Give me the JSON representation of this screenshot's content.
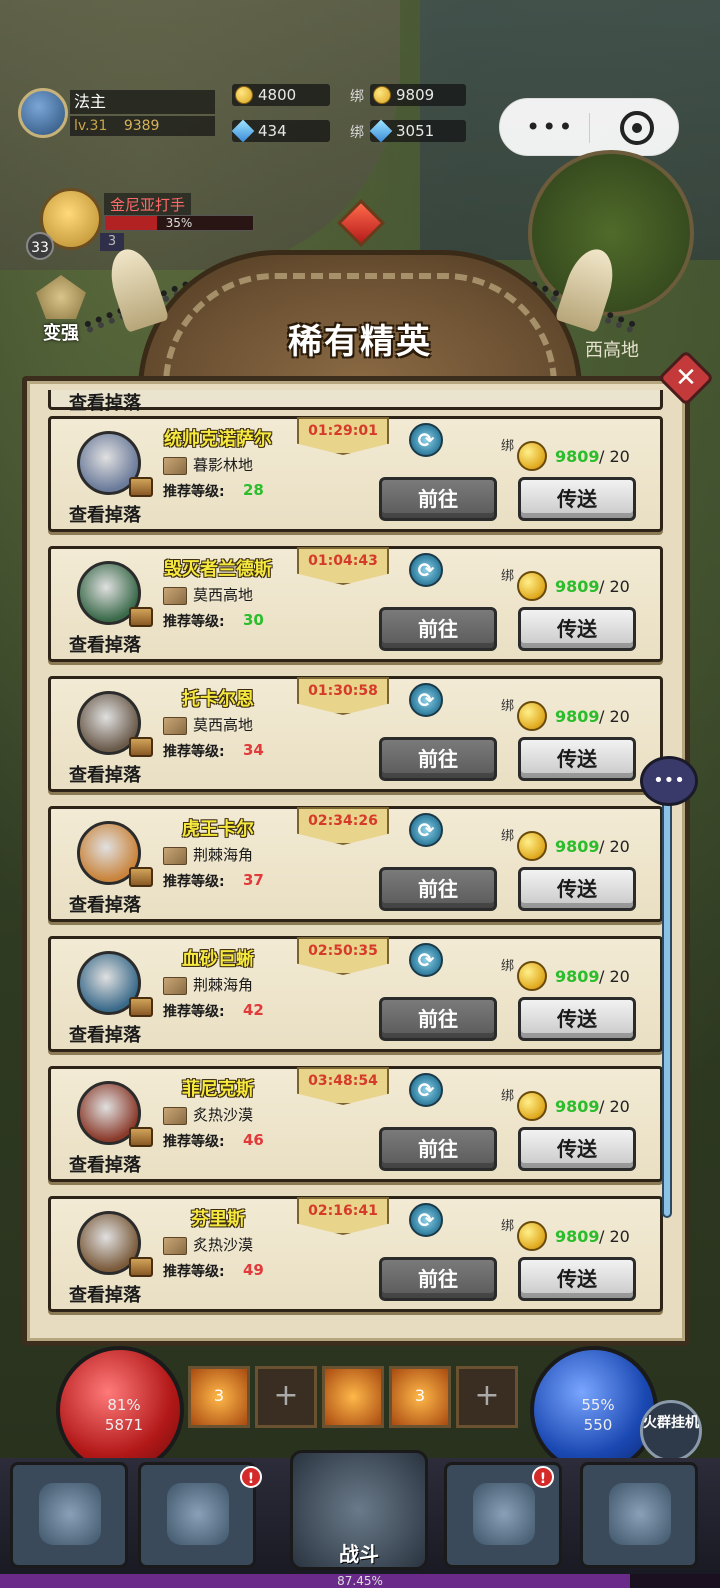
{
  "player": {
    "name": "法主",
    "level": "lv.31",
    "power": "9389"
  },
  "resources": {
    "gold": "4800",
    "bound_gold_label": "绑",
    "bound_gold": "9809",
    "gems": "434",
    "bound_gems_label": "绑",
    "bound_gems": "3051"
  },
  "hero": {
    "name": "金尼亚打手",
    "hp_text": "35%",
    "hp_fraction": 0.35,
    "level": "33",
    "count": "3"
  },
  "side_buttons": {
    "strengthen": "变强"
  },
  "minimap": {
    "label": "西高地"
  },
  "panel": {
    "title": "稀有精英",
    "close": "✕",
    "drop_label": "查看掉落",
    "rec_label": "推荐等级:",
    "go_label": "前往",
    "teleport_label": "传送",
    "bind_label": "绑",
    "bosses": [
      {
        "name": "统帅克诺萨尔",
        "timer": "01:29:01",
        "location": "暮影林地",
        "level": "28",
        "level_color": "#2bbd2b",
        "coins_have": "9809",
        "coins_need": "/ 20"
      },
      {
        "name": "毁灭者兰德斯",
        "timer": "01:04:43",
        "location": "莫西高地",
        "level": "30",
        "level_color": "#2bbd2b",
        "coins_have": "9809",
        "coins_need": "/ 20"
      },
      {
        "name": "托卡尔恩",
        "timer": "01:30:58",
        "location": "莫西高地",
        "level": "34",
        "level_color": "#e03a3a",
        "coins_have": "9809",
        "coins_need": "/ 20"
      },
      {
        "name": "虎王卡尔",
        "timer": "02:34:26",
        "location": "荆棘海角",
        "level": "37",
        "level_color": "#e03a3a",
        "coins_have": "9809",
        "coins_need": "/ 20"
      },
      {
        "name": "血砂巨蜥",
        "timer": "02:50:35",
        "location": "荆棘海角",
        "level": "42",
        "level_color": "#e03a3a",
        "coins_have": "9809",
        "coins_need": "/ 20"
      },
      {
        "name": "菲尼克斯",
        "timer": "03:48:54",
        "location": "炙热沙漠",
        "level": "46",
        "level_color": "#e03a3a",
        "coins_have": "9809",
        "coins_need": "/ 20"
      },
      {
        "name": "芬里斯",
        "timer": "02:16:41",
        "location": "炙热沙漠",
        "level": "49",
        "level_color": "#e03a3a",
        "coins_have": "9809",
        "coins_need": "/ 20"
      }
    ]
  },
  "bottom": {
    "hp_percent": "81%",
    "hp_value": "5871",
    "mp_percent": "55%",
    "mp_value": "550",
    "skill_count": "3",
    "auto_label": "火群挂机",
    "battle_label": "战斗",
    "badge": "!",
    "exp_text": "87.45%",
    "exp_fraction": 0.8745
  },
  "colors": {
    "panel_bg": "#e7dcc0",
    "boss_name": "#f6e93d",
    "timer": "#d63a2a",
    "coin_have": "#2bbd2b"
  }
}
